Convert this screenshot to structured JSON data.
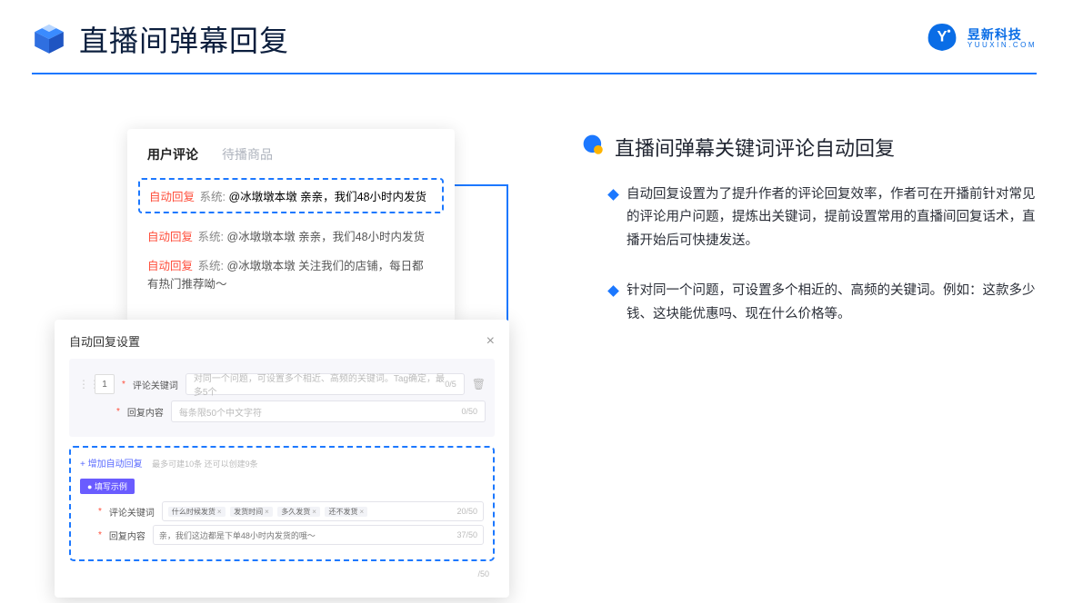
{
  "header": {
    "title": "直播间弹幕回复",
    "logo_cn": "昱新科技",
    "logo_en": "YUUXIN.COM"
  },
  "comments_panel": {
    "tabs": {
      "active": "用户评论",
      "inactive": "待播商品"
    },
    "highlighted": {
      "badge": "自动回复",
      "sys": "系统:",
      "text": "@冰墩墩本墩 亲亲，我们48小时内发货"
    },
    "rows": [
      {
        "badge": "自动回复",
        "sys": "系统:",
        "text": "@冰墩墩本墩 亲亲，我们48小时内发货"
      },
      {
        "badge": "自动回复",
        "sys": "系统:",
        "text": "@冰墩墩本墩 关注我们的店铺，每日都有热门推荐呦～"
      }
    ]
  },
  "modal": {
    "title": "自动回复设置",
    "seq": "1",
    "label_keyword": "评论关键词",
    "ph_keyword": "对同一个问题，可设置多个相近、高频的关键词。Tag确定，最多5个",
    "count_keyword": "0/5",
    "label_content": "回复内容",
    "ph_content": "每条限50个中文字符",
    "count_content": "0/50",
    "add_link": "+ 增加自动回复",
    "add_hint": "最多可建10条 还可以创建9条",
    "pill": "● 填写示例",
    "ex_label_keyword": "评论关键词",
    "ex_tags": [
      "什么时候发货",
      "发货时间",
      "多久发货",
      "还不发货"
    ],
    "ex_count_keyword": "20/50",
    "ex_label_content": "回复内容",
    "ex_content_text": "亲，我们这边都是下单48小时内发货的哦～",
    "ex_count_content": "37/50",
    "bottom_counter": "/50"
  },
  "right": {
    "section_title": "直播间弹幕关键词评论自动回复",
    "bullet1": "自动回复设置为了提升作者的评论回复效率，作者可在开播前针对常见的评论用户问题，提炼出关键词，提前设置常用的直播间回复话术，直播开始后可快捷发送。",
    "bullet2": "针对同一个问题，可设置多个相近的、高频的关键词。例如：这款多少钱、这块能优惠吗、现在什么价格等。"
  }
}
